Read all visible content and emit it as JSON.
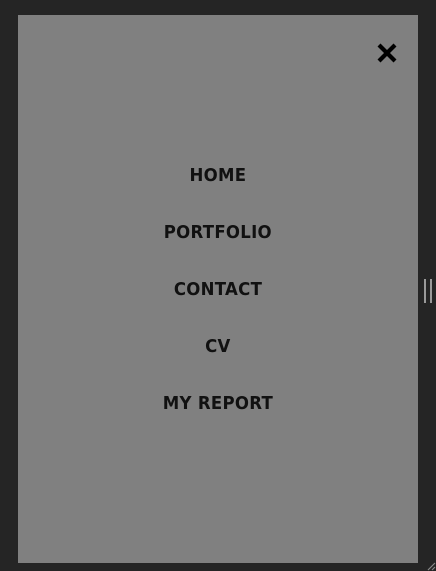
{
  "colors": {
    "background": "#252525",
    "panel": "#808080",
    "text": "#111111"
  },
  "close_button": {
    "icon": "close-icon"
  },
  "menu": {
    "items": [
      {
        "label": "HOME"
      },
      {
        "label": "PORTFOLIO"
      },
      {
        "label": "CONTACT"
      },
      {
        "label": "CV"
      },
      {
        "label": "MY REPORT"
      }
    ]
  },
  "drag_handle": {
    "icon": "drag-handle-icon"
  },
  "resize_corner": {
    "icon": "resize-corner-icon"
  }
}
